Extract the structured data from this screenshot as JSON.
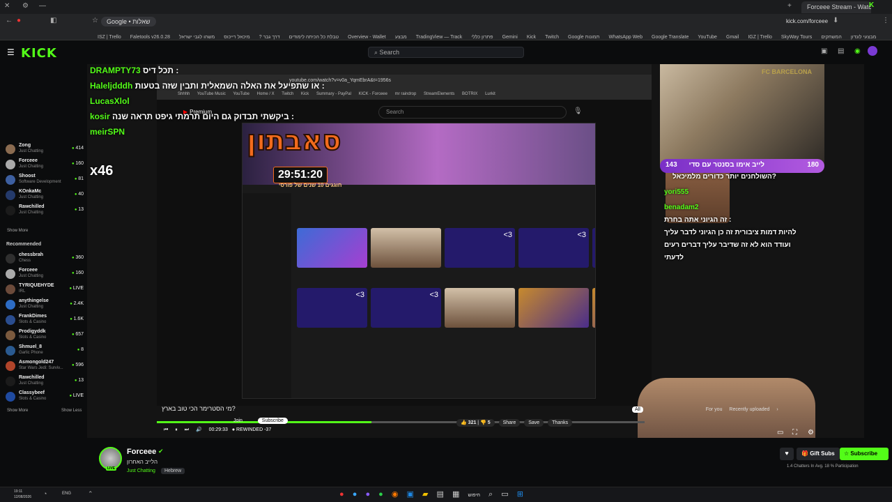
{
  "browser": {
    "tabs": [
      "Google • שאלות",
      "Forceee Stream - Watch Li"
    ],
    "url": "kick.com/forceee",
    "bookmarks": [
      "ISZ | Trello",
      "Faletools v26.0.28",
      "טבלת כל הכיתה לימודים",
      "דרך גבר ?",
      "מיכאל רייכוס",
      "משהו לגבי ישראל",
      "Overview - Wallet",
      "מבצע",
      "TradingView — Track",
      "פתרון כללי",
      "Gemini",
      "Kick",
      "Twitch",
      "Google תמונות",
      "WhatsApp Web",
      "Google Translate",
      "YouTube",
      "Gmail",
      "IGZ | Trello",
      "SkyWay Tours",
      "מבצעי לונדון",
      "המשחקים"
    ]
  },
  "kick": {
    "logo": "KICK",
    "search_placeholder": "Search"
  },
  "sidebar": {
    "following_items": [
      {
        "name": "Zong",
        "cat": "Just Chatting",
        "count": "414"
      },
      {
        "name": "Forceee",
        "cat": "Just Chatting",
        "count": "160"
      },
      {
        "name": "Shoost",
        "cat": "Software Development",
        "count": "81"
      },
      {
        "name": "KOnkaMc",
        "cat": "Just Chatting",
        "count": "40"
      },
      {
        "name": "Rawchilled",
        "cat": "Just Chatting",
        "count": "13"
      }
    ],
    "show_more": "Show More",
    "recommended_title": "Recommended",
    "recommended_items": [
      {
        "name": "chessbrah",
        "cat": "Chess",
        "count": "360"
      },
      {
        "name": "Forceee",
        "cat": "Just Chatting",
        "count": "160"
      },
      {
        "name": "TYRIQUEHYDE",
        "cat": "IRL",
        "count": "LIVE"
      },
      {
        "name": "anythingelse",
        "cat": "Just Chatting",
        "count": "2.4K"
      },
      {
        "name": "FrankDimes",
        "cat": "Slots & Casino",
        "count": "1.6K"
      },
      {
        "name": "Prodigyddk",
        "cat": "Slots & Casino",
        "count": "657"
      },
      {
        "name": "Shmuel_8",
        "cat": "Garlic Phone",
        "count": "8"
      },
      {
        "name": "Asmongold247",
        "cat": "Star Wars Jedi: Surviv...",
        "count": "596"
      },
      {
        "name": "Rawchilled",
        "cat": "Just Chatting",
        "count": "13"
      },
      {
        "name": "Classybeef",
        "cat": "Slots & Casino",
        "count": "LIVE"
      }
    ],
    "show_more_2": "Show More",
    "show_less": "Show Less"
  },
  "stream": {
    "chat_lines": [
      {
        "user": "DRAMPTY73",
        "text": "תכל דיס :"
      },
      {
        "user": "Haleljdddh",
        "text": "או שתפיעל את האלה השמאלית ותבין שזה בטעות :"
      },
      {
        "user": "LucasXlol",
        "text": ""
      },
      {
        "user": "kosir",
        "text": "ביקשתי תבדוק גם היום תרמתי גיפט תראה שנה :"
      },
      {
        "user": "meirSPN",
        "text": ""
      }
    ],
    "x_badge": "x46",
    "yt_url": "youtube.com/watch?v=v0a_YqmEbrA&t=1956s",
    "yt_search": "Search",
    "yt_logo": "Premium",
    "yt_bookmarks": [
      "Shhhh",
      "YouTube Music",
      "YouTube",
      "Home / X",
      "Twitch",
      "Kick",
      "Summary - PayPal",
      "KICK - Forceee",
      "mr raindrop",
      "StreamElements",
      "BOTRIX",
      "Lurkit"
    ],
    "marathon_title": "סאבתון",
    "timer": "29:51:20",
    "timer_sub": "חוגגים 10 שנים של פורסי",
    "thumb_label": "<3",
    "cam_label": "לייב אימו בסנטר עם סדי",
    "cam_count": "143",
    "cam_right": "180",
    "cam_team": "FC BARCELONA",
    "cam_question": "השולחנים יותר כדורים מלמיכאל?",
    "cam_user1": "yori555",
    "cam_user2": "benadam2",
    "cam_msg": [
      "זה הגיוני אתה בחרת :",
      "להיות דמות ציבורית זה כן הגיוני לדבר עליך",
      "ועודד הוא לא זה שדיבר עליך דברים רעים",
      "לדעתי"
    ],
    "yt_video_title": "מי הסטרימר הכי טוב בארץ?",
    "yt_time": "00:29:33",
    "yt_rewind": "REWINDED -37",
    "yt_progress": 0.44,
    "yt_likes": "321",
    "yt_dislikes": "5",
    "yt_share": "Share",
    "yt_save": "Save",
    "yt_thanks": "Thanks",
    "yt_chips": [
      "All",
      "For you",
      "Recently uploaded"
    ],
    "yt_join": "Join",
    "yt_subscribe": "Subscribe"
  },
  "channel": {
    "name": "Forceee",
    "title": "הלייב האחרון",
    "category": "Just Chatting",
    "tag": "Hebrew",
    "live": "LIVE",
    "gift_label": "Gift Subs",
    "subscribe_label": "Subscribe",
    "stats": "1.4 Chatters In Avg.   18 % Participation"
  },
  "taskbar": {
    "time": "19:11",
    "date": "12/08/2026",
    "lang": "ENG",
    "search_label": "חיפוש"
  },
  "colors": {
    "accent": "#53fc18",
    "bg": "#0b0c0d"
  }
}
